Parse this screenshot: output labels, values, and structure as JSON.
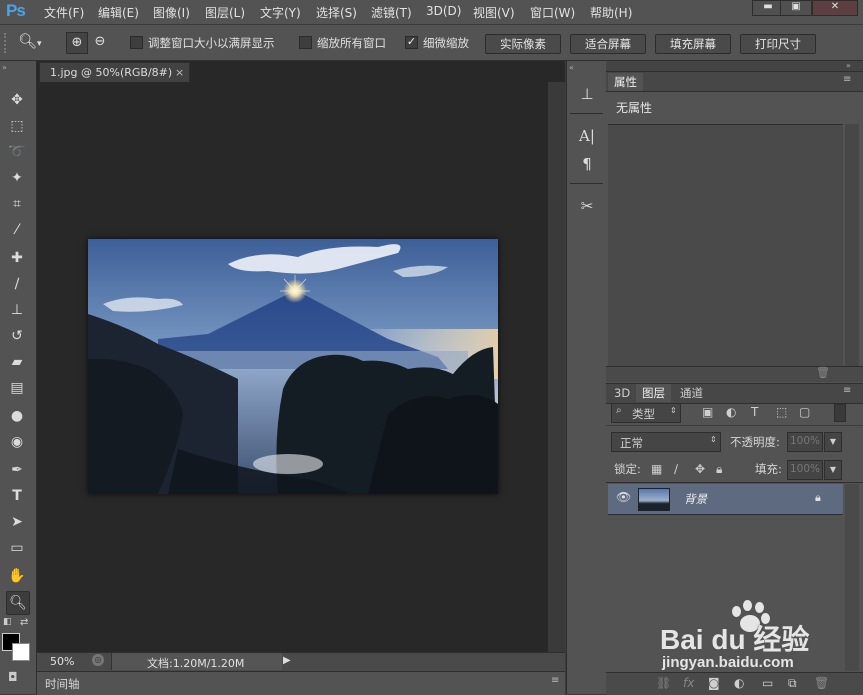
{
  "app": {
    "logo": "Ps"
  },
  "menubar": {
    "items": [
      "文件(F)",
      "编辑(E)",
      "图像(I)",
      "图层(L)",
      "文字(Y)",
      "选择(S)",
      "滤镜(T)",
      "3D(D)",
      "视图(V)",
      "窗口(W)",
      "帮助(H)"
    ]
  },
  "options": {
    "checkbox_resize": "调整窗口大小以满屏显示",
    "checkbox_zoom_all": "缩放所有窗口",
    "checkbox_scrubby": "细微缩放",
    "btn_actual_pixels": "实际像素",
    "btn_fit_screen": "适合屏幕",
    "btn_fill_screen": "填充屏幕",
    "btn_print_size": "打印尺寸"
  },
  "document": {
    "tab_title": "1.jpg @ 50%(RGB/8#)",
    "zoom": "50%",
    "doc_info": "文档:1.20M/1.20M"
  },
  "timeline": {
    "label": "时间轴"
  },
  "properties": {
    "tab": "属性",
    "no_props": "无属性"
  },
  "layers_panel": {
    "tabs": [
      "3D",
      "图层",
      "通道"
    ],
    "filter_type": "类型",
    "blend_mode": "正常",
    "opacity_label": "不透明度:",
    "opacity_value": "100%",
    "lock_label": "锁定:",
    "fill_label": "填充:",
    "fill_value": "100%",
    "layer_name": "背景"
  },
  "watermark": {
    "brand": "Bai du 经验",
    "url": "jingyan.baidu.com"
  }
}
